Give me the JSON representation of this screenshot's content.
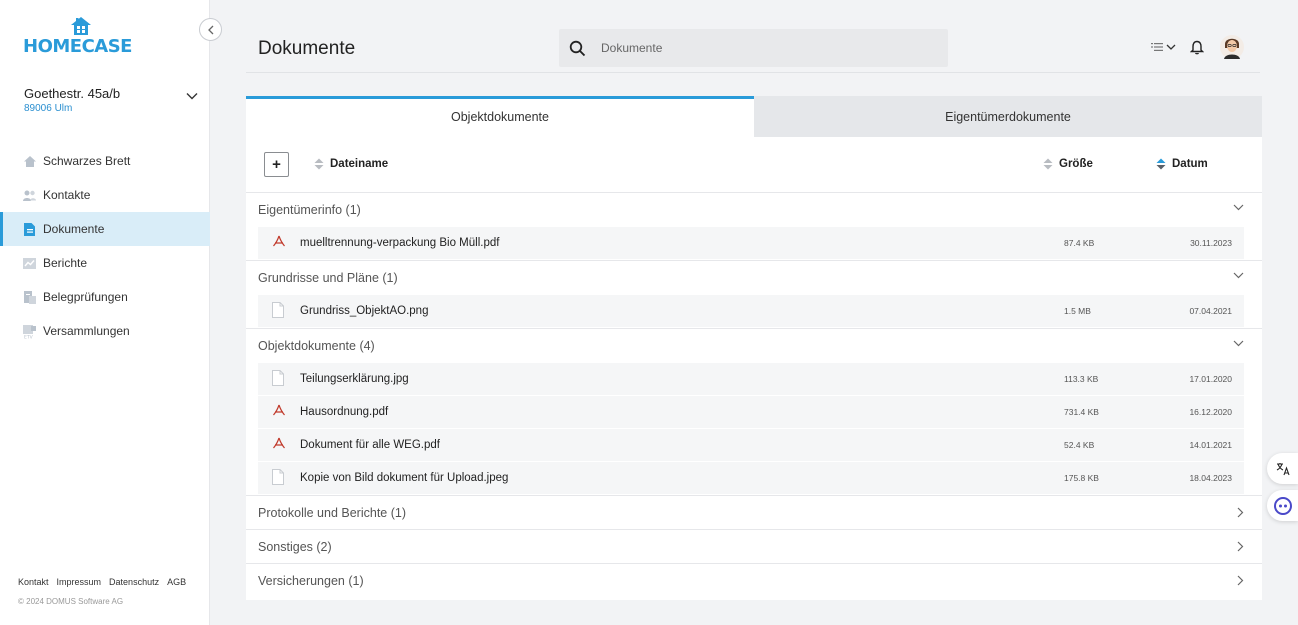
{
  "app": {
    "logo_text": "HOMECASE"
  },
  "property": {
    "street": "Goethestr. 45a/b",
    "city": "89006 Ulm"
  },
  "nav": [
    {
      "label": "Schwarzes Brett",
      "icon": "home-icon"
    },
    {
      "label": "Kontakte",
      "icon": "contacts-icon"
    },
    {
      "label": "Dokumente",
      "icon": "document-icon",
      "active": true
    },
    {
      "label": "Berichte",
      "icon": "report-icon"
    },
    {
      "label": "Belegprüfungen",
      "icon": "receipt-icon"
    },
    {
      "label": "Versammlungen",
      "icon": "meeting-icon"
    }
  ],
  "footer": {
    "links": [
      "Kontakt",
      "Impressum",
      "Datenschutz",
      "AGB"
    ],
    "copyright": "© 2024 DOMUS Software AG"
  },
  "header": {
    "title": "Dokumente",
    "search_placeholder": "Dokumente"
  },
  "tabs": [
    {
      "label": "Objektdokumente",
      "active": true
    },
    {
      "label": "Eigentümerdokumente",
      "active": false
    }
  ],
  "columns": {
    "add": "+",
    "name": "Dateiname",
    "size": "Größe",
    "date": "Datum"
  },
  "groups": [
    {
      "title": "Eigentümerinfo (1)",
      "expanded": true,
      "files": [
        {
          "name": "muelltrennung-verpackung Bio Müll.pdf",
          "type": "pdf",
          "size": "87.4 KB",
          "date": "30.11.2023"
        }
      ]
    },
    {
      "title": "Grundrisse und Pläne (1)",
      "expanded": true,
      "files": [
        {
          "name": "Grundriss_ObjektAO.png",
          "type": "generic",
          "size": "1.5 MB",
          "date": "07.04.2021"
        }
      ]
    },
    {
      "title": "Objektdokumente (4)",
      "expanded": true,
      "files": [
        {
          "name": "Teilungserklärung.jpg",
          "type": "generic",
          "size": "113.3 KB",
          "date": "17.01.2020"
        },
        {
          "name": "Hausordnung.pdf",
          "type": "pdf",
          "size": "731.4 KB",
          "date": "16.12.2020"
        },
        {
          "name": "Dokument für alle WEG.pdf",
          "type": "pdf",
          "size": "52.4 KB",
          "date": "14.01.2021"
        },
        {
          "name": "Kopie von Bild dokument für Upload.jpeg",
          "type": "generic",
          "size": "175.8 KB",
          "date": "18.04.2023"
        }
      ]
    },
    {
      "title": "Protokolle und Berichte (1)",
      "expanded": false,
      "files": []
    },
    {
      "title": "Sonstiges (2)",
      "expanded": false,
      "files": []
    },
    {
      "title": "Versicherungen (1)",
      "expanded": false,
      "files": []
    }
  ],
  "colors": {
    "accent": "#2a9bd9",
    "pdf": "#c0392b",
    "active_nav_bg": "#d9edf8"
  }
}
